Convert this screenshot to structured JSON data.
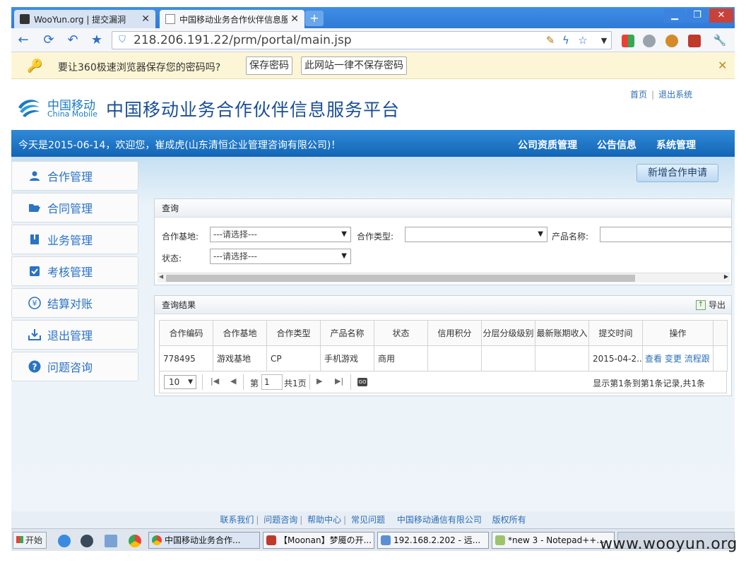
{
  "browser": {
    "tabs": [
      {
        "label": "WooYun.org | 提交漏洞"
      },
      {
        "label": "中国移动业务合作伙伴信息服"
      }
    ],
    "new_tab": "+",
    "url": "218.206.191.22/prm/portal/main.jsp",
    "password_prompt": "要让360极速浏览器保存您的密码吗?",
    "save_password": "保存密码",
    "never_save": "此网站一律不保存密码"
  },
  "site": {
    "logo_cn": "中国移动",
    "logo_en": "China Mobile",
    "title": "中国移动业务合作伙伴信息服务平台",
    "top_links": {
      "home": "首页",
      "sep": "|",
      "logout": "退出系统"
    },
    "welcome": "今天是2015-06-14，欢迎您，崔成虎(山东清恒企业管理咨询有限公司)！",
    "top_menu": [
      "公司资质管理",
      "公告信息",
      "系统管理"
    ]
  },
  "sidebar": {
    "items": [
      {
        "label": "合作管理",
        "icon": "user-icon"
      },
      {
        "label": "合同管理",
        "icon": "folder-open-icon"
      },
      {
        "label": "业务管理",
        "icon": "book-icon"
      },
      {
        "label": "考核管理",
        "icon": "checkbox-icon"
      },
      {
        "label": "结算对账",
        "icon": "yen-icon"
      },
      {
        "label": "退出管理",
        "icon": "download-icon"
      },
      {
        "label": "问题咨询",
        "icon": "question-icon"
      }
    ]
  },
  "actions": {
    "add_request": "新增合作申请"
  },
  "query": {
    "title": "查询",
    "base_label": "合作基地:",
    "base_value": "---请选择---",
    "type_label": "合作类型:",
    "type_value": "",
    "product_label": "产品名称:",
    "product_value": "",
    "status_label": "状态:",
    "status_value": "---请选择---"
  },
  "results": {
    "title": "查询结果",
    "export": "导出",
    "columns": [
      "合作编码",
      "合作基地",
      "合作类型",
      "产品名称",
      "状态",
      "信用积分",
      "分层分级级别",
      "最新账期收入",
      "提交时间",
      "操作"
    ],
    "rows": [
      {
        "code": "778495",
        "base": "游戏基地",
        "type": "CP",
        "product": "手机游戏",
        "status": "商用",
        "credit": "",
        "level": "",
        "income": "",
        "time": "2015-04-2...",
        "ops": [
          "查看",
          "变更",
          "流程跟"
        ]
      }
    ],
    "pager": {
      "page_size": "10",
      "page_prefix": "第",
      "page_num": "1",
      "page_total": "共1页",
      "go": "GO",
      "info": "显示第1条到第1条记录,共1条"
    }
  },
  "footer": {
    "links": [
      "联系我们",
      "问题咨询",
      "帮助中心",
      "常见问题"
    ],
    "company": "中国移动通信有限公司",
    "rights": "版权所有",
    "sep": "|"
  },
  "taskbar": {
    "start": "开始",
    "tasks": [
      "中国移动业务合作...",
      "【Moonan】梦魇の开...",
      "192.168.2.202 - 远...",
      "*new  3 - Notepad++..."
    ]
  },
  "watermark": "www.wooyun.org"
}
